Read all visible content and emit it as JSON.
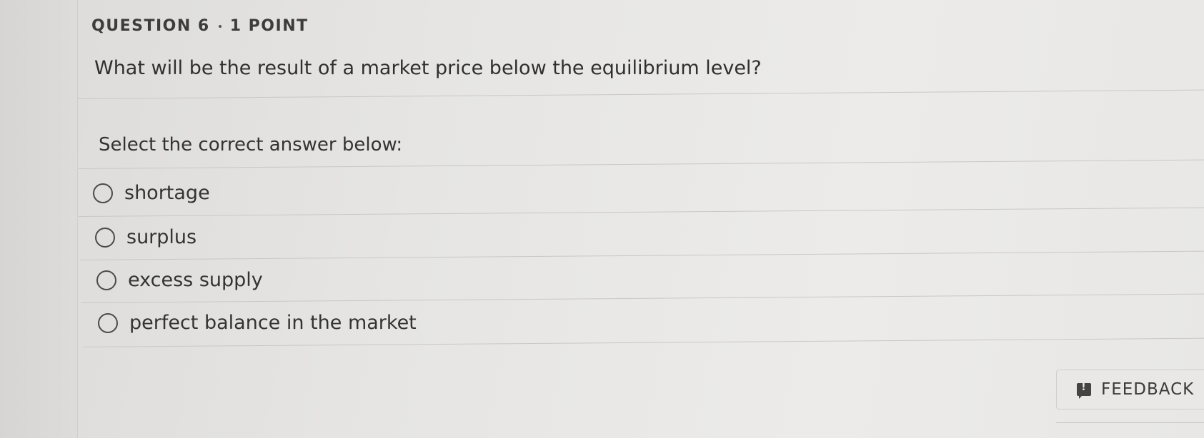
{
  "question": {
    "header_label": "QUESTION 6",
    "points_label": "1 POINT",
    "text": "What will be the result of a market price below the equilibrium level?",
    "prompt": "Select the correct answer below:"
  },
  "options": [
    {
      "label": "shortage",
      "selected": false
    },
    {
      "label": "surplus",
      "selected": false
    },
    {
      "label": "excess supply",
      "selected": false
    },
    {
      "label": "perfect balance in the market",
      "selected": false
    }
  ],
  "feedback": {
    "label": "FEEDBACK",
    "icon": "feedback-icon"
  }
}
